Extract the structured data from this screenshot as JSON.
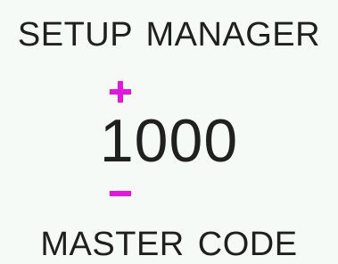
{
  "header": {
    "title": "SETUP  MANAGER"
  },
  "stepper": {
    "value": "1000",
    "increment_icon": "plus-icon",
    "decrement_icon": "minus-icon",
    "accent_color": "#e815e0"
  },
  "footer": {
    "label": "MASTER  CODE"
  },
  "colors": {
    "background": "#f6faf6",
    "text": "#1f1f1f",
    "accent": "#e815e0"
  }
}
